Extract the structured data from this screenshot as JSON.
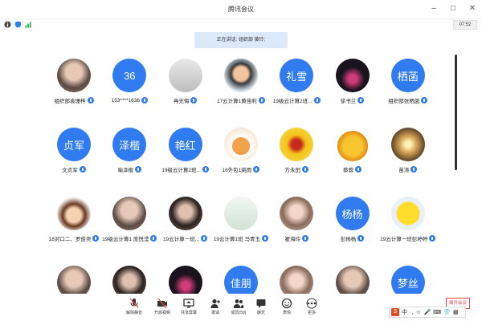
{
  "window": {
    "title": "腾讯会议",
    "clock": "07:52"
  },
  "banner": {
    "speaking": "正在讲话: 组织部 黄玲;"
  },
  "colors": {
    "accent": "#2f7bef",
    "end": "#e44444"
  },
  "participants": [
    {
      "name": "组织部袁珊梓",
      "avatar": "photo-person",
      "text": ""
    },
    {
      "name": "153****1636",
      "avatar": "text",
      "text": "36"
    },
    {
      "name": "冉无悔",
      "avatar": "photo-bird",
      "text": ""
    },
    {
      "name": "17云计算1黄佳利",
      "avatar": "photo-cartoon",
      "text": ""
    },
    {
      "name": "19级云计算2班...",
      "avatar": "text",
      "text": "礼雪"
    },
    {
      "name": "徐书兰",
      "avatar": "photo-dark",
      "text": ""
    },
    {
      "name": "组织部张栖菡",
      "avatar": "text",
      "text": "栖菡"
    },
    {
      "name": "文贞军",
      "avatar": "text",
      "text": "贞军"
    },
    {
      "name": "喻泽楷",
      "avatar": "text",
      "text": "泽楷"
    },
    {
      "name": "19级云计算2班...",
      "avatar": "text",
      "text": "艳红"
    },
    {
      "name": "16外包1姚雨",
      "avatar": "photo-dog",
      "text": ""
    },
    {
      "name": "方永田",
      "avatar": "photo-yellow",
      "text": ""
    },
    {
      "name": "蔡蓉",
      "avatar": "photo-fruit",
      "text": ""
    },
    {
      "name": "苗涛",
      "avatar": "photo-light",
      "text": ""
    },
    {
      "name": "18对口二、罗俊尧",
      "avatar": "photo-boy",
      "text": ""
    },
    {
      "name": "19级云计算1 庞悦滢",
      "avatar": "photo-person",
      "text": ""
    },
    {
      "name": "19云计算一班...",
      "avatar": "photo-girl",
      "text": ""
    },
    {
      "name": "19云计算1班 马青玉",
      "avatar": "photo-flower",
      "text": ""
    },
    {
      "name": "翟海玲",
      "avatar": "photo-anime",
      "text": ""
    },
    {
      "name": "彭杨杨",
      "avatar": "text",
      "text": "杨杨"
    },
    {
      "name": "19云计算一班彭婷婷",
      "avatar": "photo-emoji",
      "text": ""
    },
    {
      "name": "",
      "avatar": "photo-person",
      "text": ""
    },
    {
      "name": "",
      "avatar": "photo-girl",
      "text": ""
    },
    {
      "name": "",
      "avatar": "photo-dark",
      "text": ""
    },
    {
      "name": "",
      "avatar": "text",
      "text": "佳朋"
    },
    {
      "name": "",
      "avatar": "photo-anime",
      "text": ""
    },
    {
      "name": "",
      "avatar": "photo-person",
      "text": ""
    },
    {
      "name": "",
      "avatar": "text",
      "text": "梦丝"
    }
  ],
  "toolbar": [
    {
      "label": "解除静音",
      "icon": "mic-off-icon"
    },
    {
      "label": "开启视频",
      "icon": "camera-off-icon"
    },
    {
      "label": "共享屏幕",
      "icon": "share-screen-icon"
    },
    {
      "label": "邀请",
      "icon": "invite-icon"
    },
    {
      "label": "成员(59)",
      "icon": "members-icon"
    },
    {
      "label": "聊天",
      "icon": "chat-icon"
    },
    {
      "label": "表情",
      "icon": "emoji-icon"
    },
    {
      "label": "更多",
      "icon": "more-icon"
    }
  ],
  "end_button": "离开会议",
  "ime": {
    "label": "中"
  }
}
